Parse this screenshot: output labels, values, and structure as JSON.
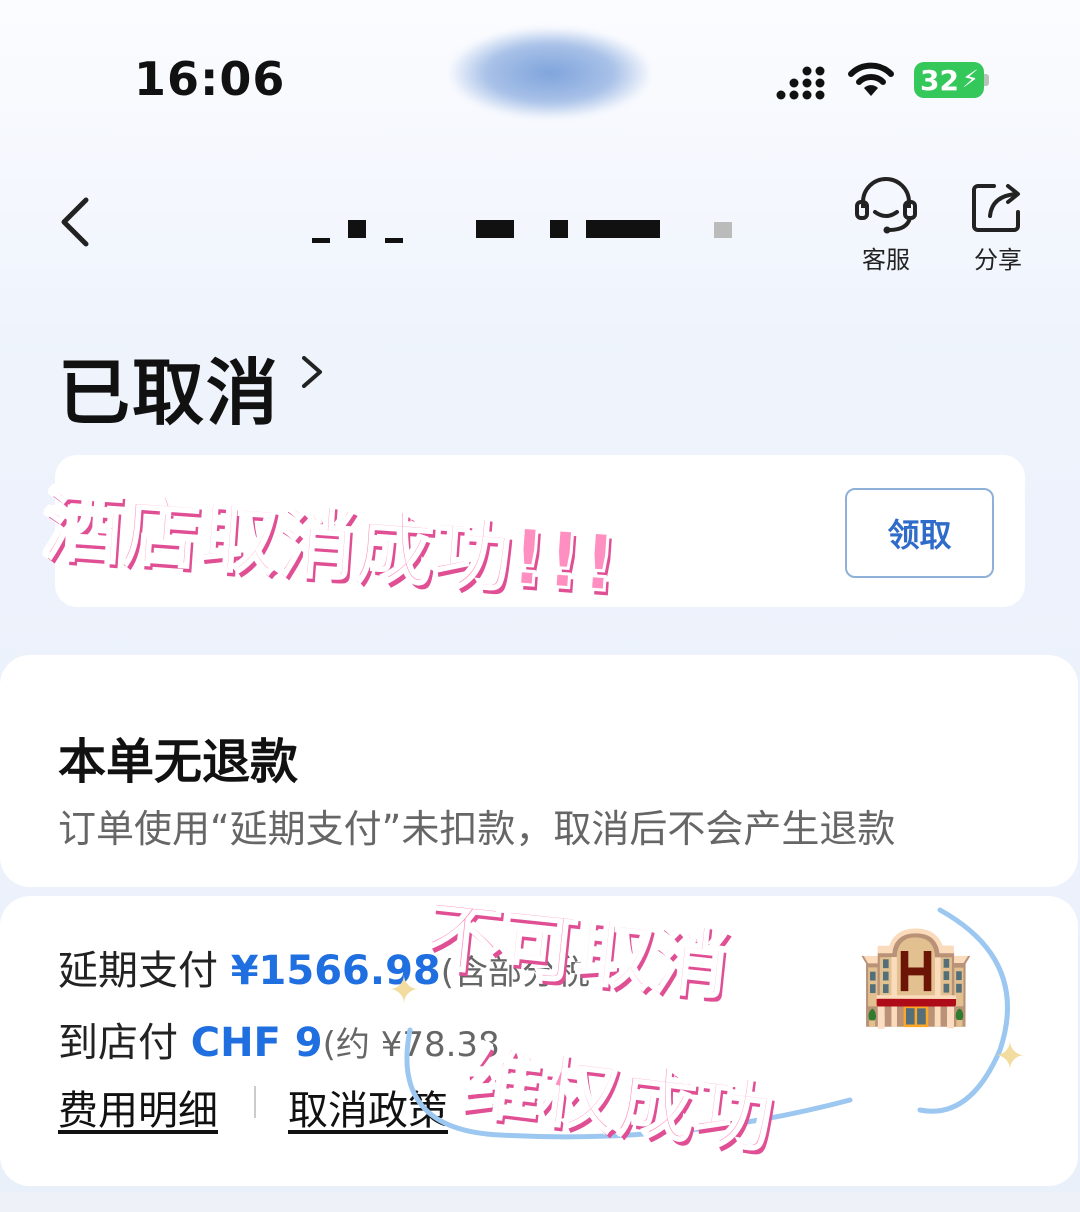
{
  "status_bar": {
    "time": "16:06",
    "battery": "32",
    "icons": [
      "signal-icon",
      "wifi-icon",
      "battery-charging-icon"
    ]
  },
  "nav": {
    "back_icon": "chevron-left-icon",
    "service": {
      "label": "客服",
      "icon": "headset-icon"
    },
    "share": {
      "label": "分享",
      "icon": "share-icon"
    }
  },
  "order": {
    "status": "已取消"
  },
  "coupon": {
    "claim_label": "领取"
  },
  "refund": {
    "title": "本单无退款",
    "description": "订单使用“延期支付”未扣款，取消后不会产生退款"
  },
  "payment": {
    "deferred_label": "延期支付",
    "deferred_amount": "¥1566.98",
    "deferred_note": "(含部分税",
    "onsite_label": "到店付",
    "onsite_amount": "CHF 9",
    "onsite_note": "(约 ¥78.38",
    "fee_details_link": "费用明细",
    "cancel_policy_link": "取消政策"
  },
  "stickers": {
    "line1": "酒店取消成功!!!",
    "line2": "不可取消",
    "line3": "维权成功",
    "hotel_emoji": "🏨"
  },
  "colors": {
    "accent_blue": "#1f6fe0",
    "sticker_pink": "#ff8fc0",
    "battery_green": "#34c759"
  }
}
